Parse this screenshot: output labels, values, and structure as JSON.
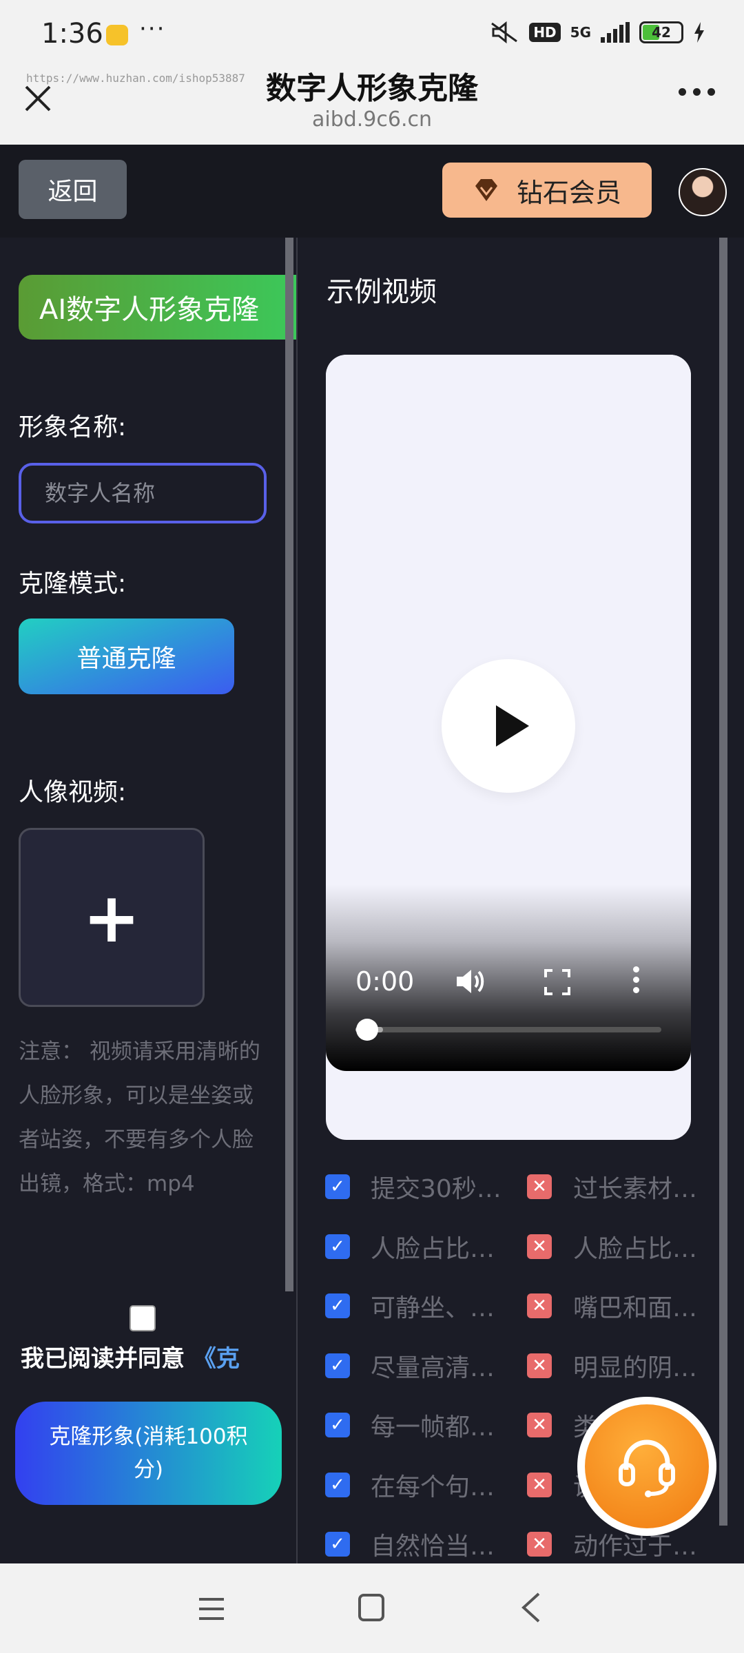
{
  "status_bar": {
    "time": "1:36",
    "dots": "···",
    "hd": "HD",
    "network": "5G",
    "battery": "42"
  },
  "browser": {
    "ghost_url": "https://www.huzhan.com/ishop53887",
    "title": "数字人形象克隆",
    "host": "aibd.9c6.cn"
  },
  "header": {
    "back_label": "返回",
    "vip_label": "钻石会员"
  },
  "left": {
    "feature_badge": "AI数字人形象克隆",
    "name_label": "形象名称:",
    "name_placeholder": "数字人名称",
    "mode_label": "克隆模式:",
    "mode_button": "普通克隆",
    "video_label": "人像视频:",
    "upload_symbol": "+",
    "note": "注意： 视频请采用清晰的人脸形象，可以是坐姿或者站姿，不要有多个人脸出镜，格式：mp4",
    "agree_text": "我已阅读并同意",
    "agree_link": "《克",
    "submit_button": "克隆形象(消耗100积分)"
  },
  "right": {
    "sample_title": "示例视频",
    "video": {
      "time": "0:00",
      "progress": 0.09
    },
    "tips": [
      {
        "good": "提交30秒…",
        "bad": "过长素材…"
      },
      {
        "good": "人脸占比…",
        "bad": "人脸占比…"
      },
      {
        "good": "可静坐、…",
        "bad": "嘴巴和面…"
      },
      {
        "good": "尽量高清…",
        "bad": "明显的阴…"
      },
      {
        "good": "每一帧都…",
        "bad": "类…"
      },
      {
        "good": "在每个句…",
        "bad": "说…"
      },
      {
        "good": "自然恰当…",
        "bad": "动作过于…"
      }
    ]
  },
  "colors": {
    "accent_purple": "#5960e8",
    "vip_orange": "#f7b88d",
    "check_blue": "#2f6cf0",
    "cross_red": "#e86b6b"
  },
  "icons": [
    "close-icon",
    "more-icon",
    "diamond-icon",
    "play-icon",
    "volume-icon",
    "fullscreen-icon",
    "headset-icon"
  ]
}
